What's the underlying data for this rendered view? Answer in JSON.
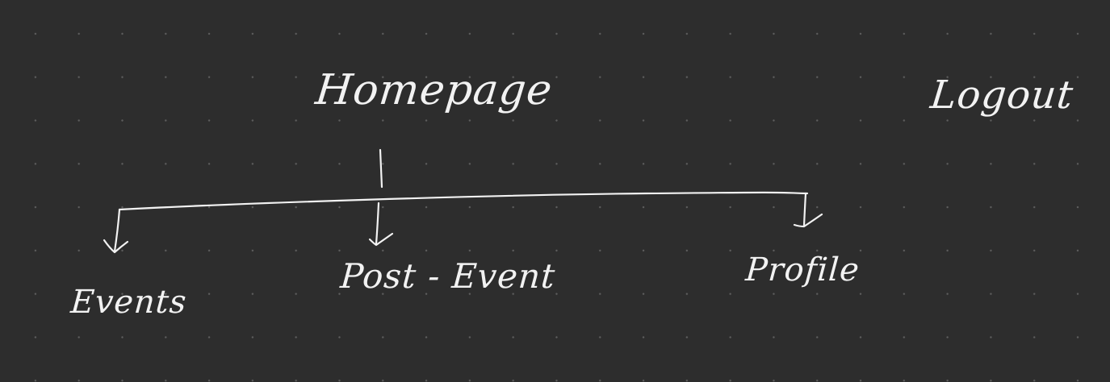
{
  "diagram": {
    "nodes": [
      {
        "id": "homepage",
        "label": "Homepage"
      },
      {
        "id": "logout",
        "label": "Logout"
      },
      {
        "id": "events",
        "label": "Events"
      },
      {
        "id": "post_event",
        "label": "Post - Event"
      },
      {
        "id": "profile",
        "label": "Profile"
      }
    ],
    "edges": [
      {
        "from": "homepage",
        "to": "events"
      },
      {
        "from": "homepage",
        "to": "post_event"
      },
      {
        "from": "homepage",
        "to": "profile"
      }
    ],
    "colors": {
      "background": "#2d2d2d",
      "ink": "#f2f2f2",
      "grid_dot": "#5e5e5e"
    }
  }
}
